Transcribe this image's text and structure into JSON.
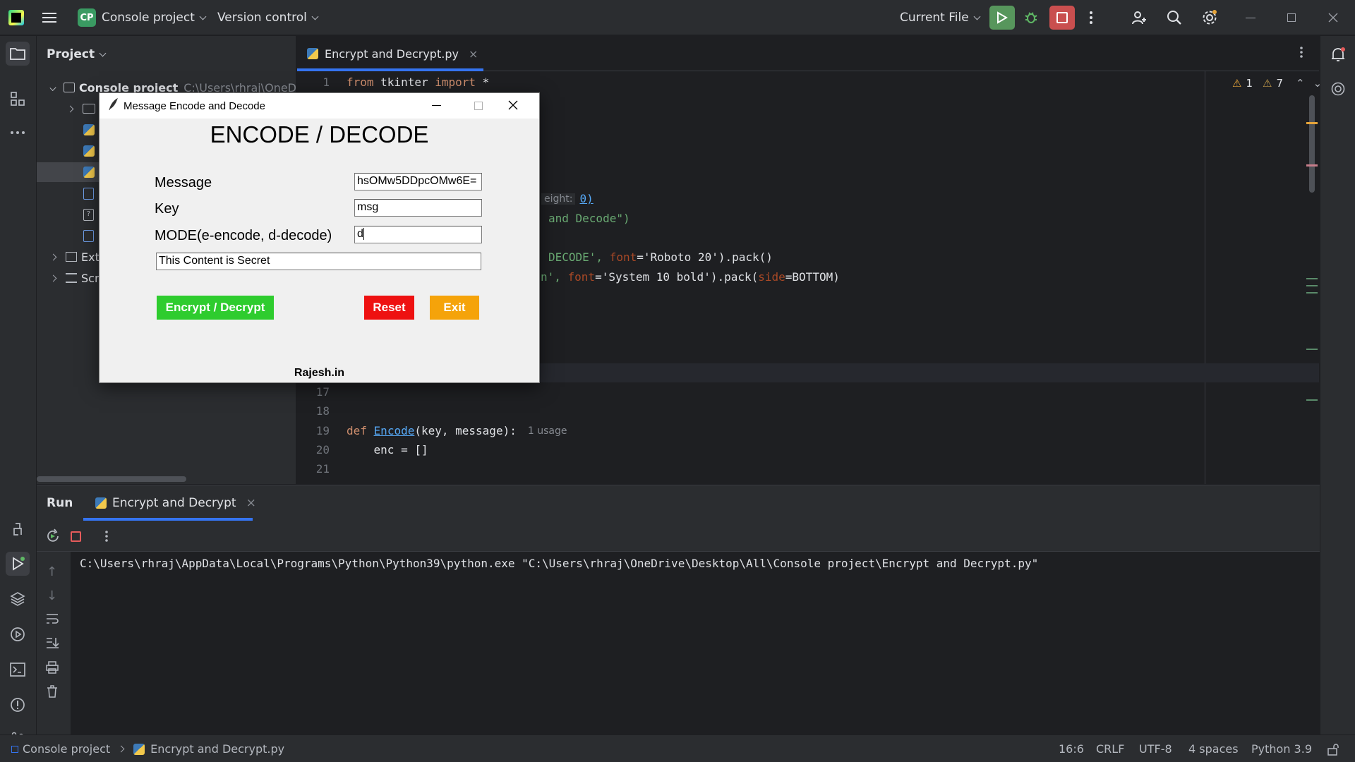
{
  "titlebar": {
    "project_badge": "CP",
    "project_name": "Console project",
    "version_control": "Version control",
    "run_config": "Current File"
  },
  "project_panel": {
    "title": "Project",
    "root_name": "Console project",
    "root_path": "C:\\Users\\rhraj\\OneD",
    "ext_label": "Ext",
    "scr_label": "Scr"
  },
  "editor": {
    "tab_label": "Encrypt and Decrypt.py",
    "warnings_a": "1",
    "warnings_b": "7",
    "code": {
      "l1_num": "1",
      "l1_from": "from",
      "l1_mod": " tkinter ",
      "l1_import": "import",
      "l1_rest": " *",
      "hint_height": "eight:",
      "hint_val": "0)",
      "l_and_decode": "and Decode\")",
      "l_decode_a": "DECODE', ",
      "l_decode_font": "font",
      "l_decode_b": "='Roboto 20').pack()",
      "l_n_a": "n', ",
      "l_n_font": "font",
      "l_n_b": "='System 10 bold').pack(",
      "l_n_side": "side",
      "l_n_c": "=BOTTOM)",
      "l17": "17",
      "l18": "18",
      "l19": "19",
      "l20": "20",
      "l21": "21",
      "l19_def": "def",
      "l19_fn": "Encode",
      "l19_args": "(key, message):",
      "l19_usage": "1 usage",
      "l20_code": "    enc = []"
    }
  },
  "run_panel": {
    "title": "Run",
    "tab_label": "Encrypt and Decrypt",
    "output": "C:\\Users\\rhraj\\AppData\\Local\\Programs\\Python\\Python39\\python.exe \"C:\\Users\\rhraj\\OneDrive\\Desktop\\All\\Console project\\Encrypt and Decrypt.py\""
  },
  "statusbar": {
    "crumb_project": "Console project",
    "crumb_file": "Encrypt and Decrypt.py",
    "position": "16:6",
    "line_sep": "CRLF",
    "encoding": "UTF-8",
    "indent": "4 spaces",
    "interpreter": "Python 3.9"
  },
  "dialog": {
    "window_title": "Message Encode and Decode",
    "heading": "ENCODE / DECODE",
    "message_label": "Message",
    "message_value": "hsOMw5DDpcOMw6E=",
    "key_label": "Key",
    "key_value": "msg",
    "mode_label": "MODE(e-encode, d-decode)",
    "mode_value": "d",
    "result_value": "This Content is Secret",
    "encrypt_button": "Encrypt / Decrypt",
    "reset_button": "Reset",
    "exit_button": "Exit",
    "footer": "Rajesh.in",
    "colors": {
      "encrypt": "#2ecc2e",
      "reset": "#ee1111",
      "exit": "#f5a30a"
    }
  }
}
